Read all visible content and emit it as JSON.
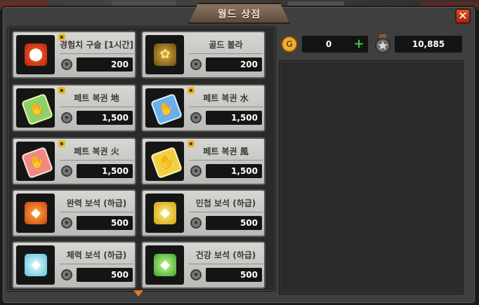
{
  "window": {
    "title": "월드 상점",
    "close_label": "✕"
  },
  "currency": {
    "gold": "0",
    "plus": "+",
    "medal": "10,885"
  },
  "items": [
    {
      "name": "경험치 구슬 [1시간]",
      "price": "200",
      "icon": "exp-orb-icon",
      "locked": true
    },
    {
      "name": "골드 볼라",
      "price": "200",
      "icon": "gold-bola-icon",
      "locked": false
    },
    {
      "name": "페트 복권 地",
      "price": "1,500",
      "icon": "pet-ticket-earth-icon",
      "locked": true
    },
    {
      "name": "페트 복권 水",
      "price": "1,500",
      "icon": "pet-ticket-water-icon",
      "locked": true
    },
    {
      "name": "페트 복권 火",
      "price": "1,500",
      "icon": "pet-ticket-fire-icon",
      "locked": true
    },
    {
      "name": "페트 복권 風",
      "price": "1,500",
      "icon": "pet-ticket-wind-icon",
      "locked": true
    },
    {
      "name": "완력 보석 (하급)",
      "price": "500",
      "icon": "strength-gem-icon",
      "locked": false
    },
    {
      "name": "민첩 보석 (하급)",
      "price": "500",
      "icon": "agility-gem-icon",
      "locked": false
    },
    {
      "name": "체력 보석 (하급)",
      "price": "500",
      "icon": "stamina-gem-icon",
      "locked": false
    },
    {
      "name": "건강 보석 (하급)",
      "price": "500",
      "icon": "health-gem-icon",
      "locked": false
    }
  ],
  "colors": {
    "accent": "#e07a20",
    "panel": "#2a2a2a",
    "card": "#c8c8c4"
  }
}
